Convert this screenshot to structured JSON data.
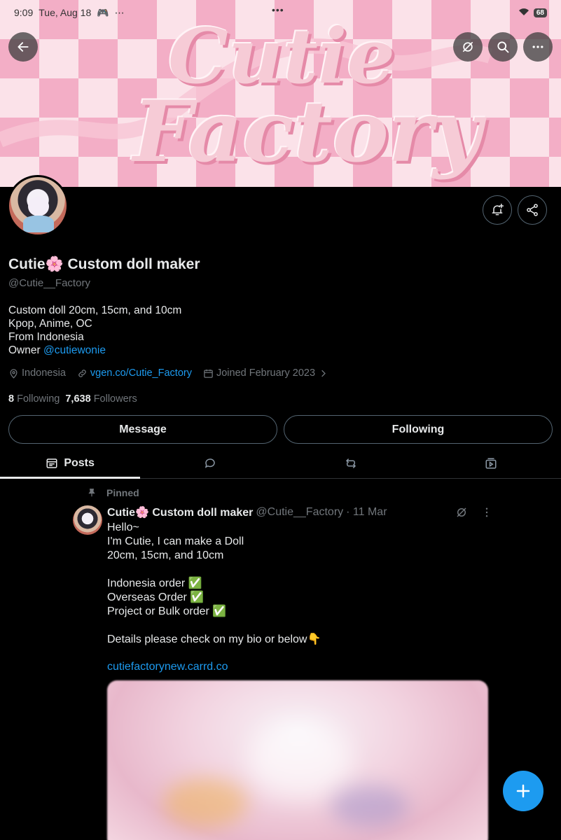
{
  "status_bar": {
    "time": "9:09",
    "date": "Tue, Aug 18",
    "battery": "68"
  },
  "banner": {
    "line1": "Cutie",
    "line2": "Factory"
  },
  "profile": {
    "display_name": "Cutie🌸 Custom doll maker",
    "handle": "@Cutie__Factory",
    "bio_lines": [
      "Custom doll 20cm, 15cm, and 10cm",
      "Kpop, Anime, OC",
      "From Indonesia"
    ],
    "bio_owner_prefix": "Owner ",
    "bio_owner_mention": "@cutiewonie",
    "location": "Indonesia",
    "website": "vgen.co/Cutie_Factory",
    "joined": "Joined February 2023",
    "following_count": "8",
    "following_label": "Following",
    "followers_count": "7,638",
    "followers_label": "Followers"
  },
  "actions": {
    "message": "Message",
    "following": "Following"
  },
  "tabs": [
    {
      "label": "Posts",
      "icon": "posts-icon",
      "active": true
    },
    {
      "label": "",
      "icon": "replies-icon"
    },
    {
      "label": "",
      "icon": "retweet-icon"
    },
    {
      "label": "",
      "icon": "media-icon"
    }
  ],
  "pinned_post": {
    "pinned_label": "Pinned",
    "author_name": "Cutie🌸 Custom doll maker",
    "author_handle": "@Cutie__Factory",
    "date": "· 11 Mar",
    "text": "Hello~\nI'm Cutie, I can make a Doll\n20cm, 15cm, and 10cm\n\nIndonesia order ✅\nOverseas Order ✅\nProject or Bulk order ✅\n\nDetails please check on my bio or below👇",
    "link": "cutiefactorynew.carrd.co"
  },
  "colors": {
    "accent": "#1d9bf0",
    "background": "#000000",
    "muted": "#71767b",
    "text": "#e7e9ea"
  }
}
